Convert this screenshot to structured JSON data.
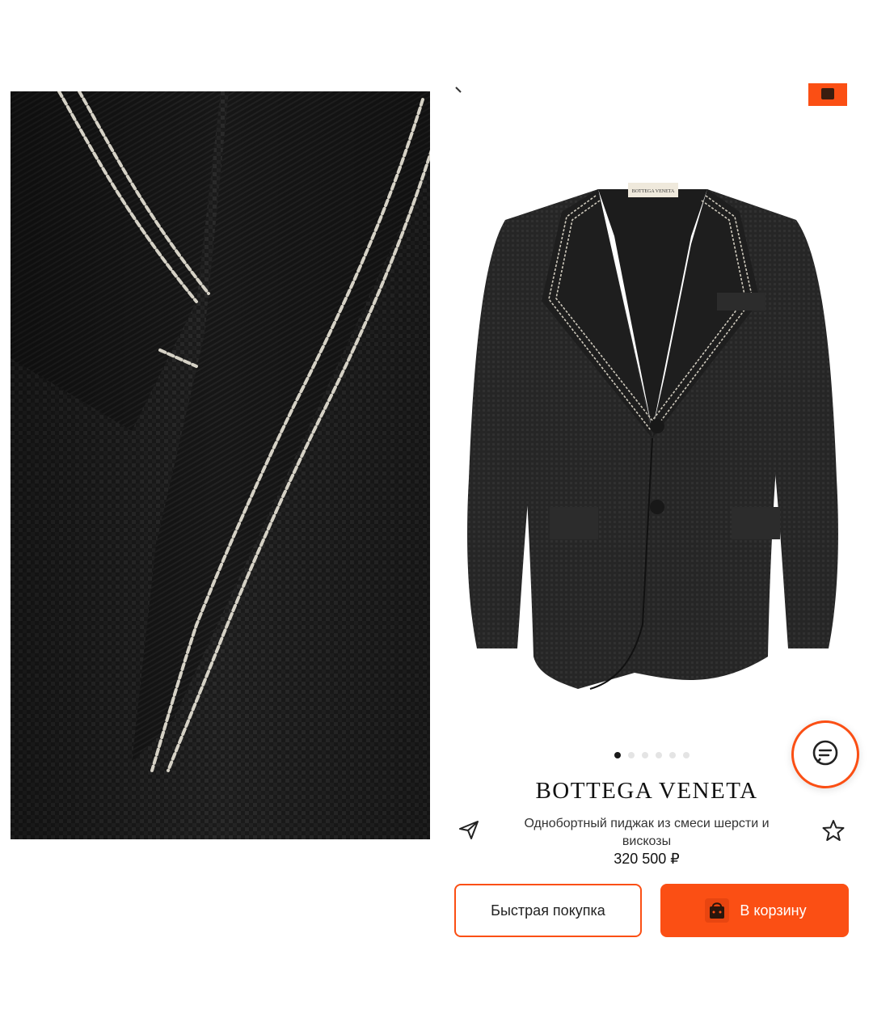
{
  "brand": "BOTTEGA VENETA",
  "product": {
    "name": "Однобортный пиджак из смеси шерсти и вискозы",
    "price": "320 500 ₽"
  },
  "gallery": {
    "total_images": 6,
    "current_index": 1
  },
  "actions": {
    "quick_buy_label": "Быстрая покупка",
    "add_to_cart_label": "В корзину"
  },
  "icons": {
    "share": "send-icon",
    "favorite": "star-icon",
    "chat": "chat-icon",
    "cart": "shopping-bag-icon",
    "back": "back-icon"
  },
  "colors": {
    "accent": "#fb4f14",
    "text": "#111111"
  },
  "jacket_label": "BOTTEGA VENETA"
}
